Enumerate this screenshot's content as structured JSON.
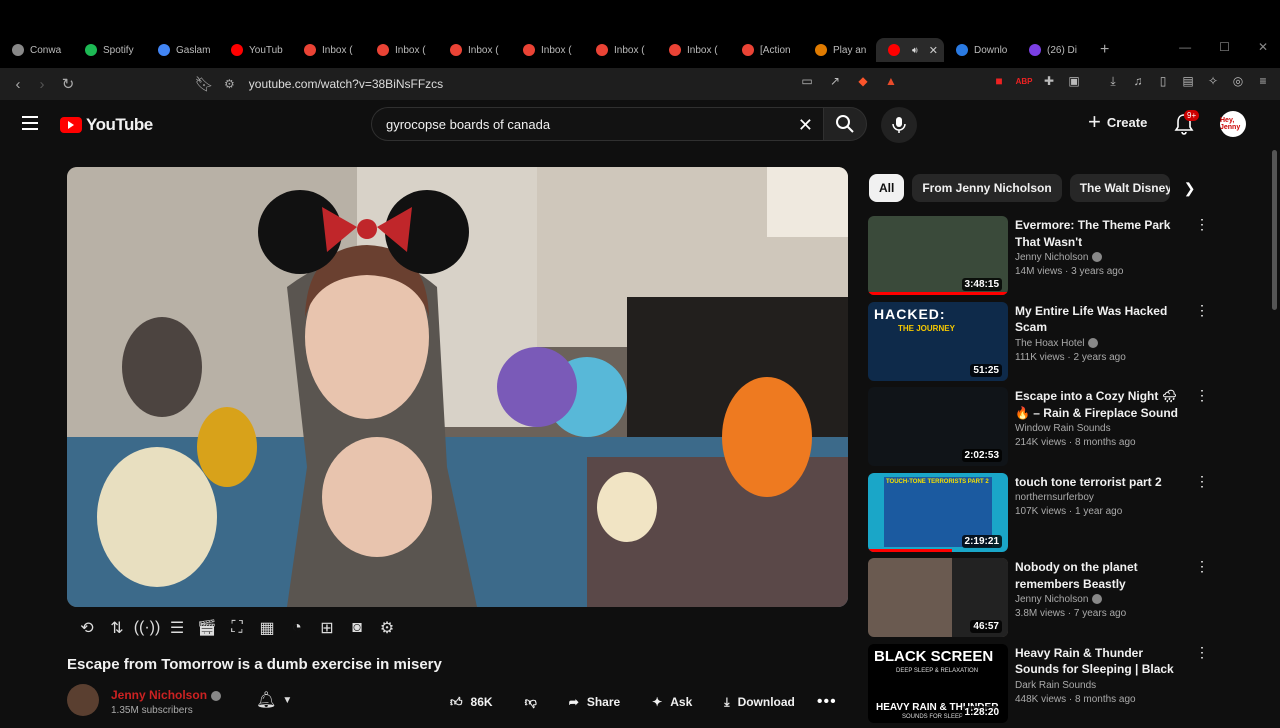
{
  "browser": {
    "tabs": [
      {
        "label": "Conwa",
        "color": "#888888"
      },
      {
        "label": "Spotify",
        "color": "#1db954"
      },
      {
        "label": "Gaslam",
        "color": "#4285f4"
      },
      {
        "label": "YouTub",
        "color": "#ff0000"
      },
      {
        "label": "Inbox (",
        "color": "#ea4335"
      },
      {
        "label": "Inbox (",
        "color": "#ea4335"
      },
      {
        "label": "Inbox (",
        "color": "#ea4335"
      },
      {
        "label": "Inbox (",
        "color": "#ea4335"
      },
      {
        "label": "Inbox (",
        "color": "#ea4335"
      },
      {
        "label": "Inbox (",
        "color": "#ea4335"
      },
      {
        "label": "[Action",
        "color": "#ea4335"
      },
      {
        "label": "Play an",
        "color": "#e07b00"
      },
      {
        "label": "",
        "color": "#ff0000",
        "active": true
      },
      {
        "label": "Downlo",
        "color": "#2a7ae2"
      },
      {
        "label": "(26) Di",
        "color": "#7b3fe4"
      }
    ],
    "url": "youtube.com/watch?v=38BiNsFFzcs",
    "new_tab": "+"
  },
  "header": {
    "logo_text": "YouTube",
    "search_value": "gyrocopse boards of canada",
    "create_label": "Create",
    "notif_badge": "9+",
    "avatar_text": "Hey, Jenny"
  },
  "video": {
    "title": "Escape from Tomorrow is a dumb exercise in misery",
    "channel": "Jenny Nicholson",
    "subscribers": "1.35M subscribers",
    "likes": "86K",
    "share_label": "Share",
    "ask_label": "Ask",
    "download_label": "Download"
  },
  "chips": [
    "All",
    "From Jenny Nicholson",
    "The Walt Disney Co"
  ],
  "recommendations": [
    {
      "title": "Evermore: The Theme Park That Wasn't",
      "channel": "Jenny Nicholson",
      "verified": true,
      "meta": "14M views · 3 years ago",
      "duration": "3:48:15",
      "progress": 1.0,
      "thumb_bg": "#3a4a3a"
    },
    {
      "title": "My Entire Life Was Hacked Scam",
      "channel": "The Hoax Hotel",
      "verified": true,
      "meta": "111K views · 2 years ago",
      "duration": "51:25",
      "progress": 0,
      "thumb_bg": "#0e2a4a"
    },
    {
      "title": "Escape into a Cozy Night 🌧🔥 – Rain & Fireplace Sound for ...",
      "channel": "Window Rain Sounds",
      "verified": false,
      "meta": "214K views · 8 months ago",
      "duration": "2:02:53",
      "progress": 0,
      "thumb_bg": "#101418"
    },
    {
      "title": "touch tone terrorist part 2",
      "channel": "northernsurferboy",
      "verified": false,
      "meta": "107K views · 1 year ago",
      "duration": "2:19:21",
      "progress": 0.6,
      "thumb_bg": "#1aa6c8"
    },
    {
      "title": "Nobody on the planet remembers Beastly",
      "channel": "Jenny Nicholson",
      "verified": true,
      "meta": "3.8M views · 7 years ago",
      "duration": "46:57",
      "progress": 0,
      "thumb_bg": "#6a5a50"
    },
    {
      "title": "Heavy Rain & Thunder Sounds for Sleeping | Black Screen for...",
      "channel": "Dark Rain Sounds",
      "verified": false,
      "meta": "448K views · 8 months ago",
      "duration": "1:28:20",
      "progress": 0,
      "thumb_bg": "#000000"
    }
  ],
  "thumb_text": {
    "hacked_1": "HACKED:",
    "hacked_2": "THE JOURNEY",
    "ttt": "TOUCH-TONE TERRORISTS PART 2",
    "bs_1": "BLACK SCREEN",
    "bs_2": "DEEP SLEEP & RELAXATION",
    "bs_3": "HEAVY RAIN & THUNDER",
    "bs_4": "SOUNDS FOR SLEEP"
  },
  "colors": {
    "accent": "#ff0000",
    "bg": "#0f0f0f"
  }
}
